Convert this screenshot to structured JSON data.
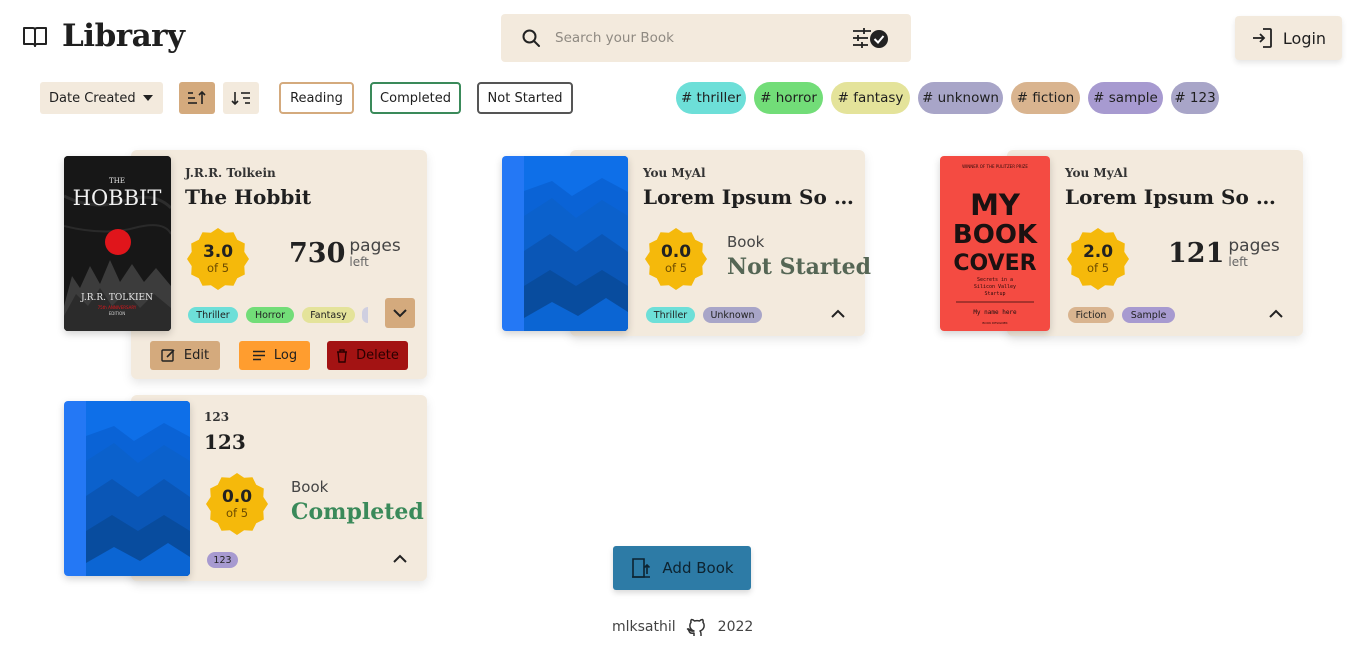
{
  "header": {
    "title": "Library",
    "search_placeholder": "Search your Book",
    "login_label": "Login"
  },
  "toolbar": {
    "sort_by": "Date Created",
    "sort_order": "ascending",
    "filters": [
      "Reading",
      "Completed",
      "Not Started"
    ],
    "tags": [
      "# thriller",
      "# horror",
      "# fantasy",
      "# unknown",
      "# fiction",
      "# sample",
      "# 123"
    ]
  },
  "books": [
    {
      "author": "J.R.R. Tolkein",
      "title": "The Hobbit",
      "rating": "3.0",
      "rating_of": "of 5",
      "pages_left": "730",
      "pages_label": "pages",
      "left_label": "left",
      "tags": [
        "Thriller",
        "Horror",
        "Fantasy"
      ],
      "cover": {
        "top_line": "THE",
        "title": "HOBBIT",
        "author": "J.R.R. TOLKIEN",
        "note": "75th ANNIVERSARY",
        "edition": "EDITION"
      },
      "actions": {
        "edit": "Edit",
        "log": "Log",
        "delete": "Delete"
      }
    },
    {
      "author": "You MyAl",
      "title": "Lorem Ipsum So So...",
      "rating": "0.0",
      "rating_of": "of 5",
      "status_label": "Book",
      "status": "Not Started",
      "tags": [
        "Thriller",
        "Unknown"
      ]
    },
    {
      "author": "You MyAl",
      "title": "Lorem Ipsum So So...",
      "rating": "2.0",
      "rating_of": "of 5",
      "pages_left": "121",
      "pages_label": "pages",
      "left_label": "left",
      "tags": [
        "Fiction",
        "Sample"
      ],
      "cover": {
        "top_line": "WINNER OF THE PULITZER PRIZE",
        "line1": "MY",
        "line2": "BOOK",
        "line3": "COVER",
        "sub1": "Secrets in a",
        "sub2": "Silicon Valley",
        "sub3": "Startup",
        "name": "My name here",
        "small": "BOOK DESIGNER"
      }
    },
    {
      "author": "123",
      "title": "123",
      "rating": "0.0",
      "rating_of": "of 5",
      "status_label": "Book",
      "status": "Completed",
      "tags": [
        "123"
      ]
    }
  ],
  "add_book_label": "Add Book",
  "footer": {
    "user": "mlksathil",
    "year": "2022"
  },
  "colors": {
    "card_bg": "#f3eadd",
    "badge": "#f5b90b",
    "thriller": "#6ddfd8",
    "horror": "#72dd78",
    "fantasy": "#e4e39a",
    "unknown": "#a8a5c8",
    "fiction": "#d9b48f",
    "sample": "#a79ad0",
    "completed_text": "#3a8a5a",
    "not_started_text": "#556655",
    "delete": "#a31313",
    "log": "#ff9d2f",
    "edit": "#d4aa7d",
    "add_book": "#2d7ba6"
  }
}
